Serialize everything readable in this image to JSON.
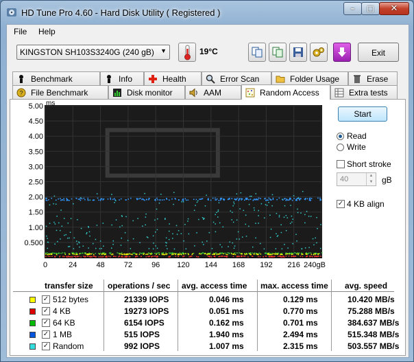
{
  "window": {
    "title": "HD Tune Pro 4.60 - Hard Disk Utility (  Registered )",
    "min_glyph": "–",
    "max_glyph": "□",
    "close_glyph": "✕"
  },
  "menu": {
    "file": "File",
    "help": "Help"
  },
  "toolbar": {
    "drive": "KINGSTON SH103S3240G (240 gB)",
    "temperature": "19°C",
    "exit_label": "Exit"
  },
  "tabs_row1": [
    {
      "label": "Benchmark",
      "icon": "benchmark-icon"
    },
    {
      "label": "Info",
      "icon": "info-icon"
    },
    {
      "label": "Health",
      "icon": "health-icon"
    },
    {
      "label": "Error Scan",
      "icon": "error-scan-icon"
    },
    {
      "label": "Folder Usage",
      "icon": "folder-icon"
    },
    {
      "label": "Erase",
      "icon": "erase-icon"
    }
  ],
  "tabs_row2": [
    {
      "label": "File Benchmark",
      "icon": "file-benchmark-icon"
    },
    {
      "label": "Disk monitor",
      "icon": "disk-monitor-icon"
    },
    {
      "label": "AAM",
      "icon": "speaker-icon"
    },
    {
      "label": "Random Access",
      "icon": "random-access-icon",
      "active": true
    },
    {
      "label": "Extra tests",
      "icon": "extra-tests-icon"
    }
  ],
  "chart_data": {
    "type": "scatter",
    "ylabel": "ms",
    "y_ticks": [
      "5.00",
      "4.50",
      "4.00",
      "3.50",
      "3.00",
      "2.50",
      "2.00",
      "1.50",
      "1.00",
      "0.500"
    ],
    "x_ticks": [
      "0",
      "24",
      "48",
      "72",
      "96",
      "120",
      "144",
      "168",
      "192",
      "216",
      "240gB"
    ],
    "xlim": [
      0,
      240
    ],
    "ylim": [
      0,
      5
    ],
    "background": "#1b1b1b",
    "series": [
      {
        "name": "512 bytes",
        "color": "#ffff00",
        "band_ms": 0.129
      },
      {
        "name": "4 KB",
        "color": "#ff3333",
        "band_ms": 0.05
      },
      {
        "name": "64 KB",
        "color": "#33cc33",
        "band_ms": 0.16
      },
      {
        "name": "1 MB",
        "color": "#3399ff",
        "band_ms": 1.94
      },
      {
        "name": "Random",
        "color": "#33cccc",
        "band_ms": 1.0
      }
    ]
  },
  "side": {
    "start_label": "Start",
    "read_label": "Read",
    "write_label": "Write",
    "mode": "read",
    "short_stroke_label": "Short stroke",
    "short_stroke_checked": false,
    "short_stroke_value": "40",
    "gb_label": "gB",
    "align_label": "4 KB align",
    "align_checked": true
  },
  "table": {
    "headers": [
      "transfer size",
      "operations / sec",
      "avg. access time",
      "max. access time",
      "avg. speed"
    ],
    "rows": [
      {
        "size": "512 bytes",
        "color": "#ffff00",
        "ops": "21339 IOPS",
        "avg": "0.046 ms",
        "max": "0.129 ms",
        "speed": "10.420 MB/s"
      },
      {
        "size": "4 KB",
        "color": "#dd0000",
        "ops": "19273 IOPS",
        "avg": "0.051 ms",
        "max": "0.770 ms",
        "speed": "75.288 MB/s"
      },
      {
        "size": "64 KB",
        "color": "#00bb00",
        "ops": "6154 IOPS",
        "avg": "0.162 ms",
        "max": "0.701 ms",
        "speed": "384.637 MB/s"
      },
      {
        "size": "1 MB",
        "color": "#0055dd",
        "ops": "515 IOPS",
        "avg": "1.940 ms",
        "max": "2.494 ms",
        "speed": "515.348 MB/s"
      },
      {
        "size": "Random",
        "color": "#33dddd",
        "ops": "992 IOPS",
        "avg": "1.007 ms",
        "max": "2.315 ms",
        "speed": "503.557 MB/s"
      }
    ]
  }
}
